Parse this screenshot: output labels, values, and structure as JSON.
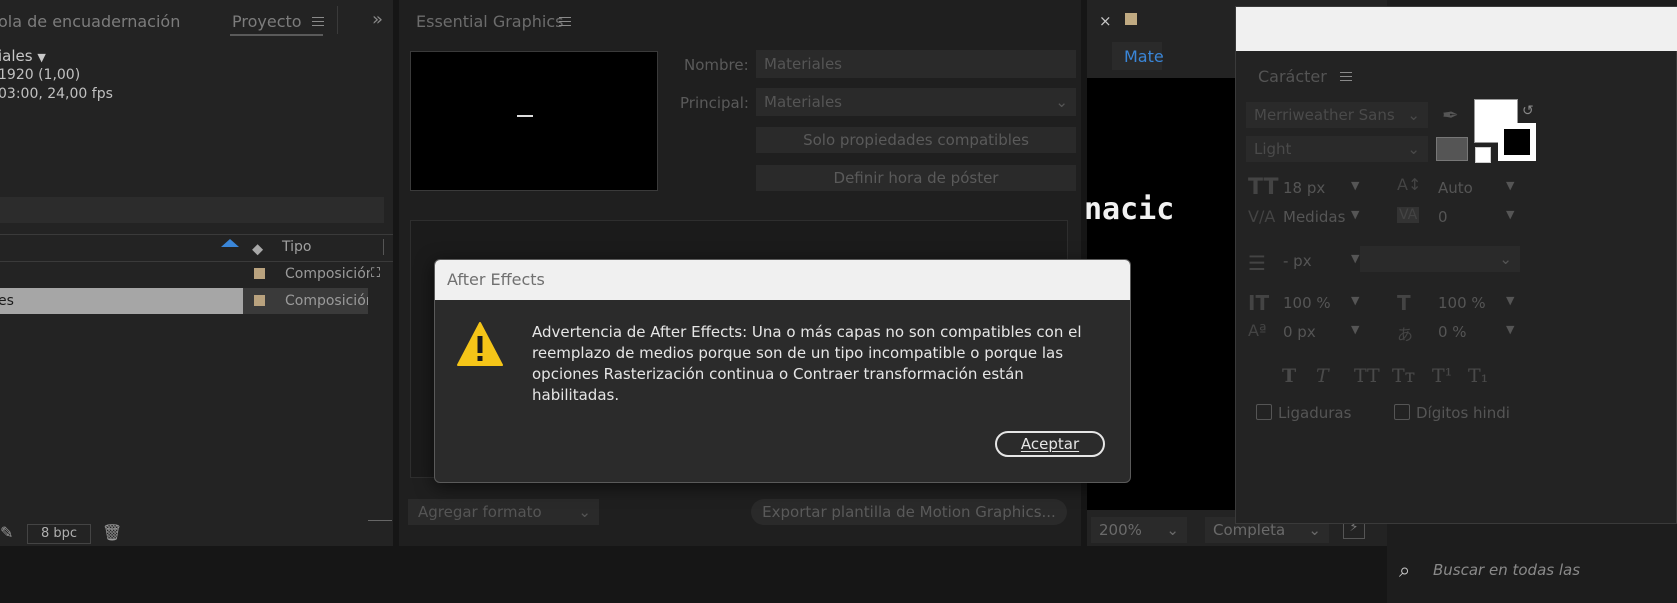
{
  "project_panel": {
    "tab_label": "ola de encuadernación",
    "project_tab": "Proyecto",
    "comp_name": "iales",
    "comp_res": "1920 (1,00)",
    "comp_dur": "03:00, 24,00 fps",
    "col_type_header": "Tipo",
    "rows": [
      {
        "name": "",
        "type": "Composición"
      },
      {
        "name": "es",
        "type": "Composición"
      }
    ],
    "bpc": "8 bpc"
  },
  "essential_graphics": {
    "title": "Essential Graphics",
    "name_label": "Nombre:",
    "name_value": "Materiales",
    "primary_label": "Principal:",
    "primary_value": "Materiales",
    "solo_button": "Solo propiedades compatibles",
    "poster_button": "Definir hora de póster",
    "add_format": "Agregar formato",
    "export_button": "Exportar plantilla de Motion Graphics..."
  },
  "viewer": {
    "tab_label": "Mate",
    "preview_text": "nacic",
    "zoom": "200%",
    "quality": "Completa",
    "close_glyph": "×"
  },
  "character_panel": {
    "title": "Carácter",
    "font_family": "Merriweather Sans",
    "font_style": "Light",
    "font_size": "18 px",
    "leading": "Auto",
    "kerning": "Medidas",
    "tracking": "0",
    "stroke_width": "- px",
    "vscale": "100 %",
    "hscale": "100 %",
    "baseline": "0 px",
    "tsume": "0 %",
    "ligatures": "Ligaduras",
    "hindi_digits": "Dígitos hindi",
    "style_buttons": [
      "T",
      "T",
      "TT",
      "Tт",
      "T¹",
      "T₁"
    ]
  },
  "search": {
    "placeholder": "Buscar en todas las"
  },
  "dialog": {
    "title": "After Effects",
    "message": "Advertencia de After Effects: Una o más capas no son compatibles con el reemplazo de medios porque son de un tipo incompatible o porque las opciones Rasterización continua o Contraer transformación están habilitadas.",
    "ok_label": "Aceptar",
    "colors": {
      "warning": "#f5c518",
      "title_bar": "#f0f0f0",
      "body": "#2b2b2b"
    }
  }
}
